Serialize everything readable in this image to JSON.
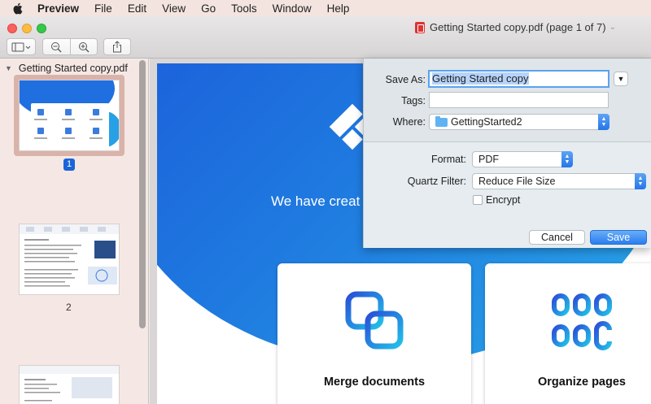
{
  "menubar": {
    "app_name": "Preview",
    "items": [
      "File",
      "Edit",
      "View",
      "Go",
      "Tools",
      "Window",
      "Help"
    ]
  },
  "window": {
    "title": "Getting Started copy.pdf (page 1 of 7)",
    "title_icon": "pdf-icon"
  },
  "sidebar": {
    "document_name": "Getting Started copy.pdf",
    "pages": [
      {
        "number": "1",
        "selected": true
      },
      {
        "number": "2",
        "selected": false
      }
    ]
  },
  "page": {
    "hero_text": "We have creat",
    "cards": [
      {
        "label": "Merge documents",
        "icon": "merge-icon"
      },
      {
        "label": "Organize pages",
        "icon": "organize-icon"
      }
    ]
  },
  "save_dialog": {
    "save_as_label": "Save As:",
    "save_as_value": "Getting Started copy",
    "tags_label": "Tags:",
    "tags_value": "",
    "where_label": "Where:",
    "where_value": "GettingStarted2",
    "format_label": "Format:",
    "format_value": "PDF",
    "quartz_label": "Quartz Filter:",
    "quartz_value": "Reduce File Size",
    "encrypt_label": "Encrypt",
    "encrypt_checked": false,
    "cancel_label": "Cancel",
    "save_label": "Save"
  },
  "colors": {
    "accent": "#2a7cf0",
    "brand_blue": "#1f6fe0",
    "sidebar_bg": "#f5e8e4"
  }
}
